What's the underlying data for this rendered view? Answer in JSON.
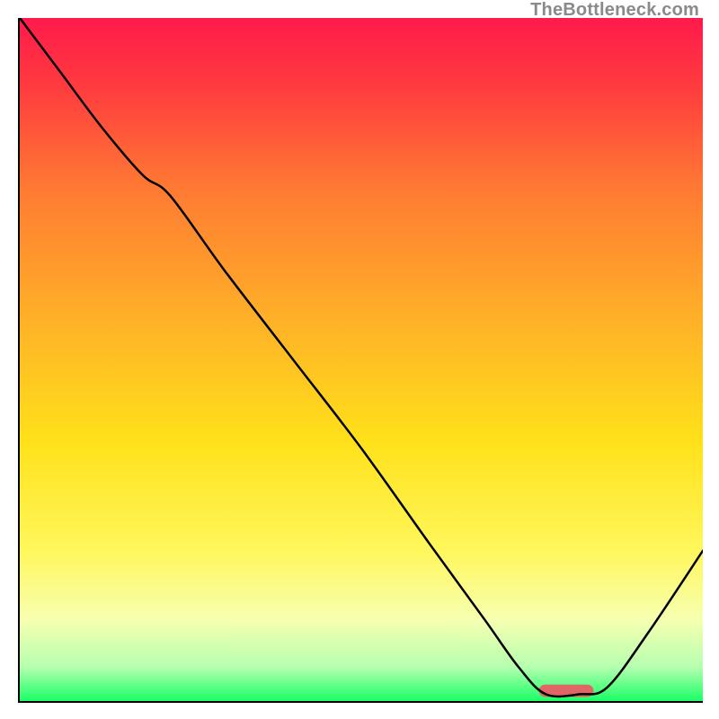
{
  "watermark": "TheBottleneck.com",
  "chart_data": {
    "type": "line",
    "title": "",
    "xlabel": "",
    "ylabel": "",
    "xlim": [
      0,
      100
    ],
    "ylim": [
      0,
      100
    ],
    "gradient_stops": [
      {
        "pct": 0,
        "color": "#ff1a4b"
      },
      {
        "pct": 10,
        "color": "#ff3b3f"
      },
      {
        "pct": 25,
        "color": "#ff7a33"
      },
      {
        "pct": 45,
        "color": "#ffb327"
      },
      {
        "pct": 62,
        "color": "#ffe11a"
      },
      {
        "pct": 78,
        "color": "#fff75c"
      },
      {
        "pct": 88,
        "color": "#f7ffb0"
      },
      {
        "pct": 95,
        "color": "#b6ffb0"
      },
      {
        "pct": 100,
        "color": "#1aff66"
      }
    ],
    "series": [
      {
        "name": "bottleneck-curve",
        "x": [
          0,
          6,
          12,
          18,
          22,
          30,
          40,
          50,
          60,
          68,
          73,
          77,
          82,
          86,
          92,
          100
        ],
        "y": [
          100,
          92,
          84,
          77,
          74,
          63,
          50,
          37,
          23,
          12,
          5,
          1,
          1,
          2,
          10,
          22
        ]
      }
    ],
    "marker": {
      "name": "optimal-range",
      "x_start": 76,
      "x_end": 84,
      "y": 1.5,
      "color": "#e06666",
      "height": 1.8
    }
  }
}
